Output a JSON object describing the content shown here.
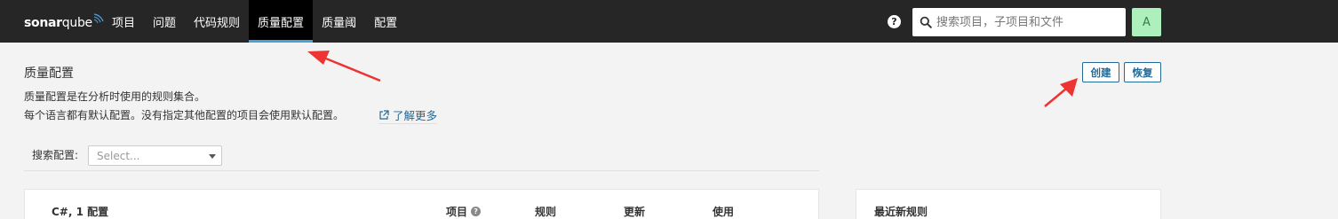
{
  "header": {
    "logo": {
      "part1": "sonar",
      "part2": "qube"
    },
    "nav": [
      {
        "label": "项目",
        "active": false
      },
      {
        "label": "问题",
        "active": false
      },
      {
        "label": "代码规则",
        "active": false
      },
      {
        "label": "质量配置",
        "active": true
      },
      {
        "label": "质量阈",
        "active": false
      },
      {
        "label": "配置",
        "active": false
      }
    ],
    "help_icon": "?",
    "search": {
      "placeholder": "搜索项目，子项目和文件",
      "value": ""
    },
    "avatar": "A"
  },
  "page": {
    "title": "质量配置",
    "description_line1": "质量配置是在分析时使用的规则集合。",
    "description_line2": "每个语言都有默认配置。没有指定其他配置的项目会使用默认配置。",
    "learn_more": "了解更多",
    "create_button": "创建",
    "restore_button": "恢复"
  },
  "filter": {
    "label": "搜索配置:",
    "select_placeholder": "Select..."
  },
  "profiles_table": {
    "language_header": "C#, 1 配置",
    "columns": [
      "项目",
      "规则",
      "更新",
      "使用"
    ]
  },
  "side_panel": {
    "title": "最近新规则"
  },
  "colors": {
    "topbar": "#262626",
    "accent": "#4b9fd5",
    "link": "#236a97",
    "avatar_bg": "#aef0bd",
    "annotation_arrow": "#ee3333"
  }
}
